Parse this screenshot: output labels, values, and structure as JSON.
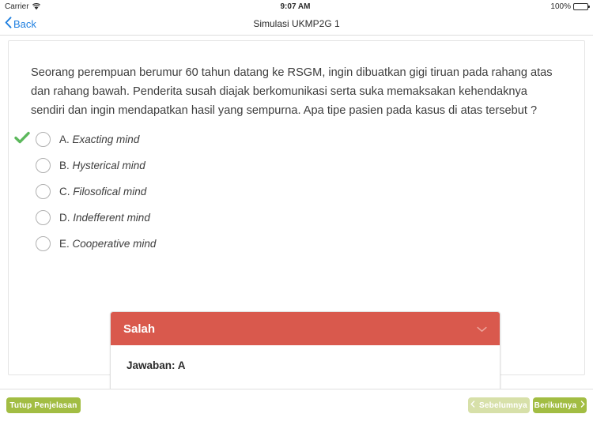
{
  "status_bar": {
    "carrier": "Carrier",
    "wifi_icon": "wifi-icon",
    "time": "9:07 AM",
    "battery_percent": "100%",
    "battery_icon": "battery-icon"
  },
  "nav_bar": {
    "back_label": "Back",
    "back_icon": "chevron-left-icon",
    "title": "Simulasi UKMP2G 1"
  },
  "question": {
    "text": "Seorang perempuan berumur 60 tahun datang ke RSGM, ingin dibuatkan gigi tiruan pada rahang atas dan rahang bawah. Penderita susah diajak berkomunikasi serta suka memaksakan kehendaknya sendiri dan ingin mendapatkan hasil yang sempurna. Apa tipe pasien pada kasus di atas tersebut ?"
  },
  "options": [
    {
      "letter": "A.",
      "text": "Exacting mind",
      "selected": false,
      "correct": true
    },
    {
      "letter": "B.",
      "text": "Hysterical mind",
      "selected": false,
      "correct": false
    },
    {
      "letter": "C.",
      "text": "Filosofical mind",
      "selected": false,
      "correct": false
    },
    {
      "letter": "D.",
      "text": "Indefferent mind",
      "selected": false,
      "correct": false
    },
    {
      "letter": "E.",
      "text": "Cooperative mind",
      "selected": false,
      "correct": false
    }
  ],
  "result_panel": {
    "header_title": "Salah",
    "collapse_icon": "chevron-down-icon",
    "answer_text": "Jawaban: A",
    "header_color": "#d9594d"
  },
  "toolbar": {
    "close_explanation_label": "Tutup Penjelasan",
    "previous_label": "Sebelumnya",
    "previous_icon": "chevron-left-icon",
    "previous_disabled": true,
    "next_label": "Berikutnya",
    "next_icon": "chevron-right-icon"
  },
  "colors": {
    "accent_green": "#a2bd43",
    "disabled_green": "#d7e0a9",
    "error_red": "#d9594d",
    "check_green": "#5cb85c",
    "link_blue": "#1f7fe0"
  }
}
